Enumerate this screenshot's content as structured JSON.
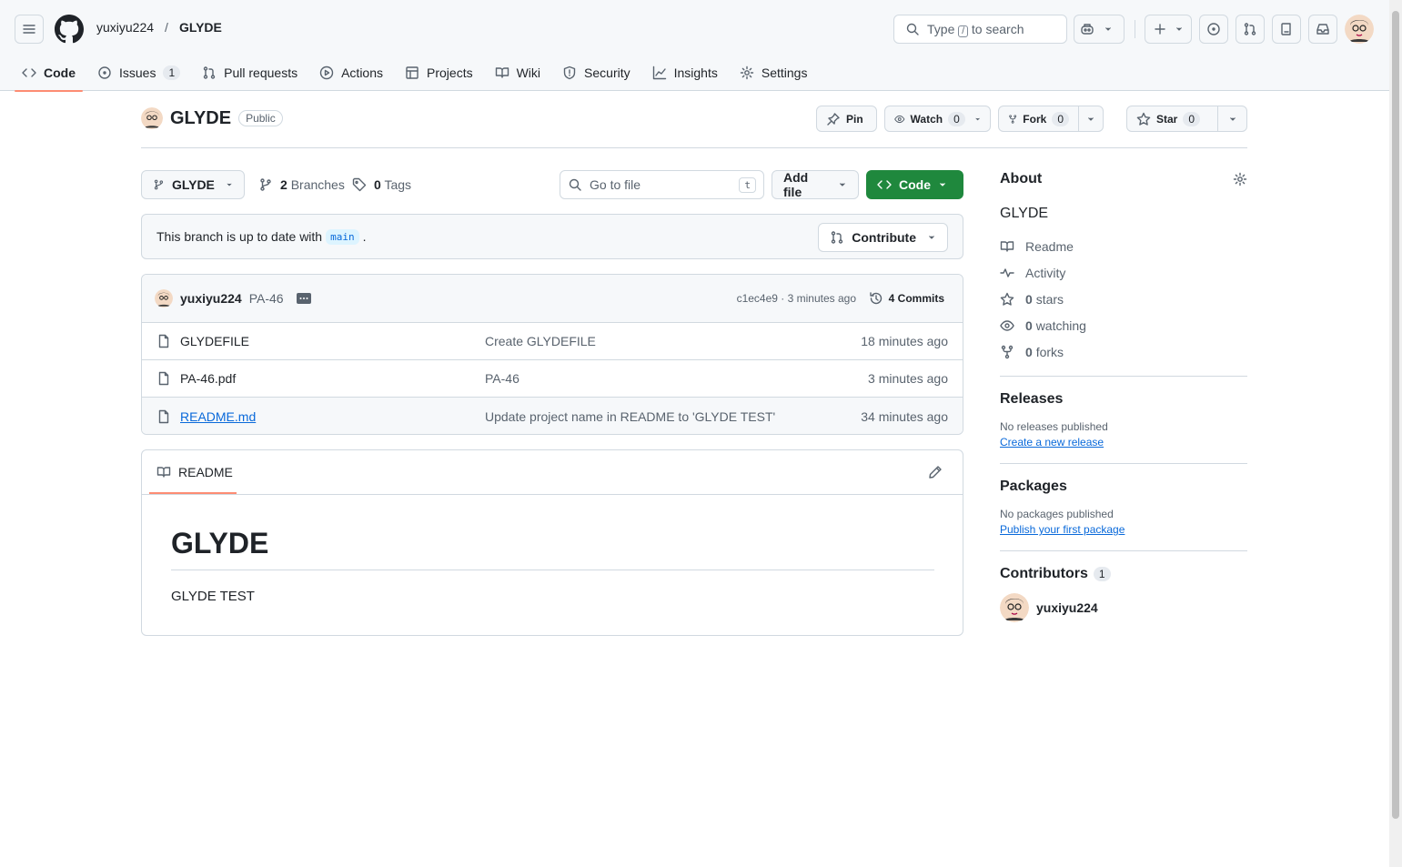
{
  "header": {
    "owner": "yuxiyu224",
    "separator": "/",
    "repo": "GLYDE",
    "search_type": "Type",
    "search_key": "/",
    "search_rest": "to search"
  },
  "tabs": [
    {
      "label": "Code",
      "icon": "code-icon"
    },
    {
      "label": "Issues",
      "icon": "issue-icon",
      "count": "1"
    },
    {
      "label": "Pull requests",
      "icon": "pull-request-icon"
    },
    {
      "label": "Actions",
      "icon": "play-icon"
    },
    {
      "label": "Projects",
      "icon": "table-icon"
    },
    {
      "label": "Wiki",
      "icon": "book-icon"
    },
    {
      "label": "Security",
      "icon": "shield-icon"
    },
    {
      "label": "Insights",
      "icon": "graph-icon"
    },
    {
      "label": "Settings",
      "icon": "gear-icon"
    }
  ],
  "repo": {
    "name": "GLYDE",
    "visibility": "Public",
    "pin": "Pin",
    "watch": "Watch",
    "watch_count": "0",
    "fork": "Fork",
    "fork_count": "0",
    "star": "Star",
    "star_count": "0"
  },
  "branchbar": {
    "branch": "GLYDE",
    "branches_count": "2",
    "branches_label": "Branches",
    "tags_count": "0",
    "tags_label": "Tags",
    "gofile_placeholder": "Go to file",
    "gofile_key": "t",
    "add_file": "Add file",
    "code": "Code"
  },
  "status": {
    "text": "This branch is up to date with",
    "branch": "main",
    "end": ".",
    "contribute": "Contribute"
  },
  "commit": {
    "author": "yuxiyu224",
    "message": "PA-46",
    "sha_time": "c1ec4e9 · 3 minutes ago",
    "commits": "4 Commits"
  },
  "files": [
    {
      "name": "GLYDEFILE",
      "message": "Create GLYDEFILE",
      "time": "18 minutes ago"
    },
    {
      "name": "PA-46.pdf",
      "message": "PA-46",
      "time": "3 minutes ago"
    },
    {
      "name": "README.md",
      "message": "Update project name in README to 'GLYDE TEST'",
      "time": "34 minutes ago"
    }
  ],
  "readme": {
    "tab": "README",
    "heading": "GLYDE",
    "body": "GLYDE TEST"
  },
  "about": {
    "title": "About",
    "description": "GLYDE",
    "readme": "Readme",
    "activity": "Activity",
    "stars_count": "0",
    "stars": "stars",
    "watching_count": "0",
    "watching": "watching",
    "forks_count": "0",
    "forks": "forks"
  },
  "releases": {
    "title": "Releases",
    "none": "No releases published",
    "link": "Create a new release"
  },
  "packages": {
    "title": "Packages",
    "none": "No packages published",
    "link": "Publish your first package"
  },
  "contributors": {
    "title": "Contributors",
    "count": "1",
    "user": "yuxiyu224"
  },
  "colors": {
    "accent_tab": "#fd8c73",
    "code_button": "#1f883d",
    "link": "#0969da"
  }
}
